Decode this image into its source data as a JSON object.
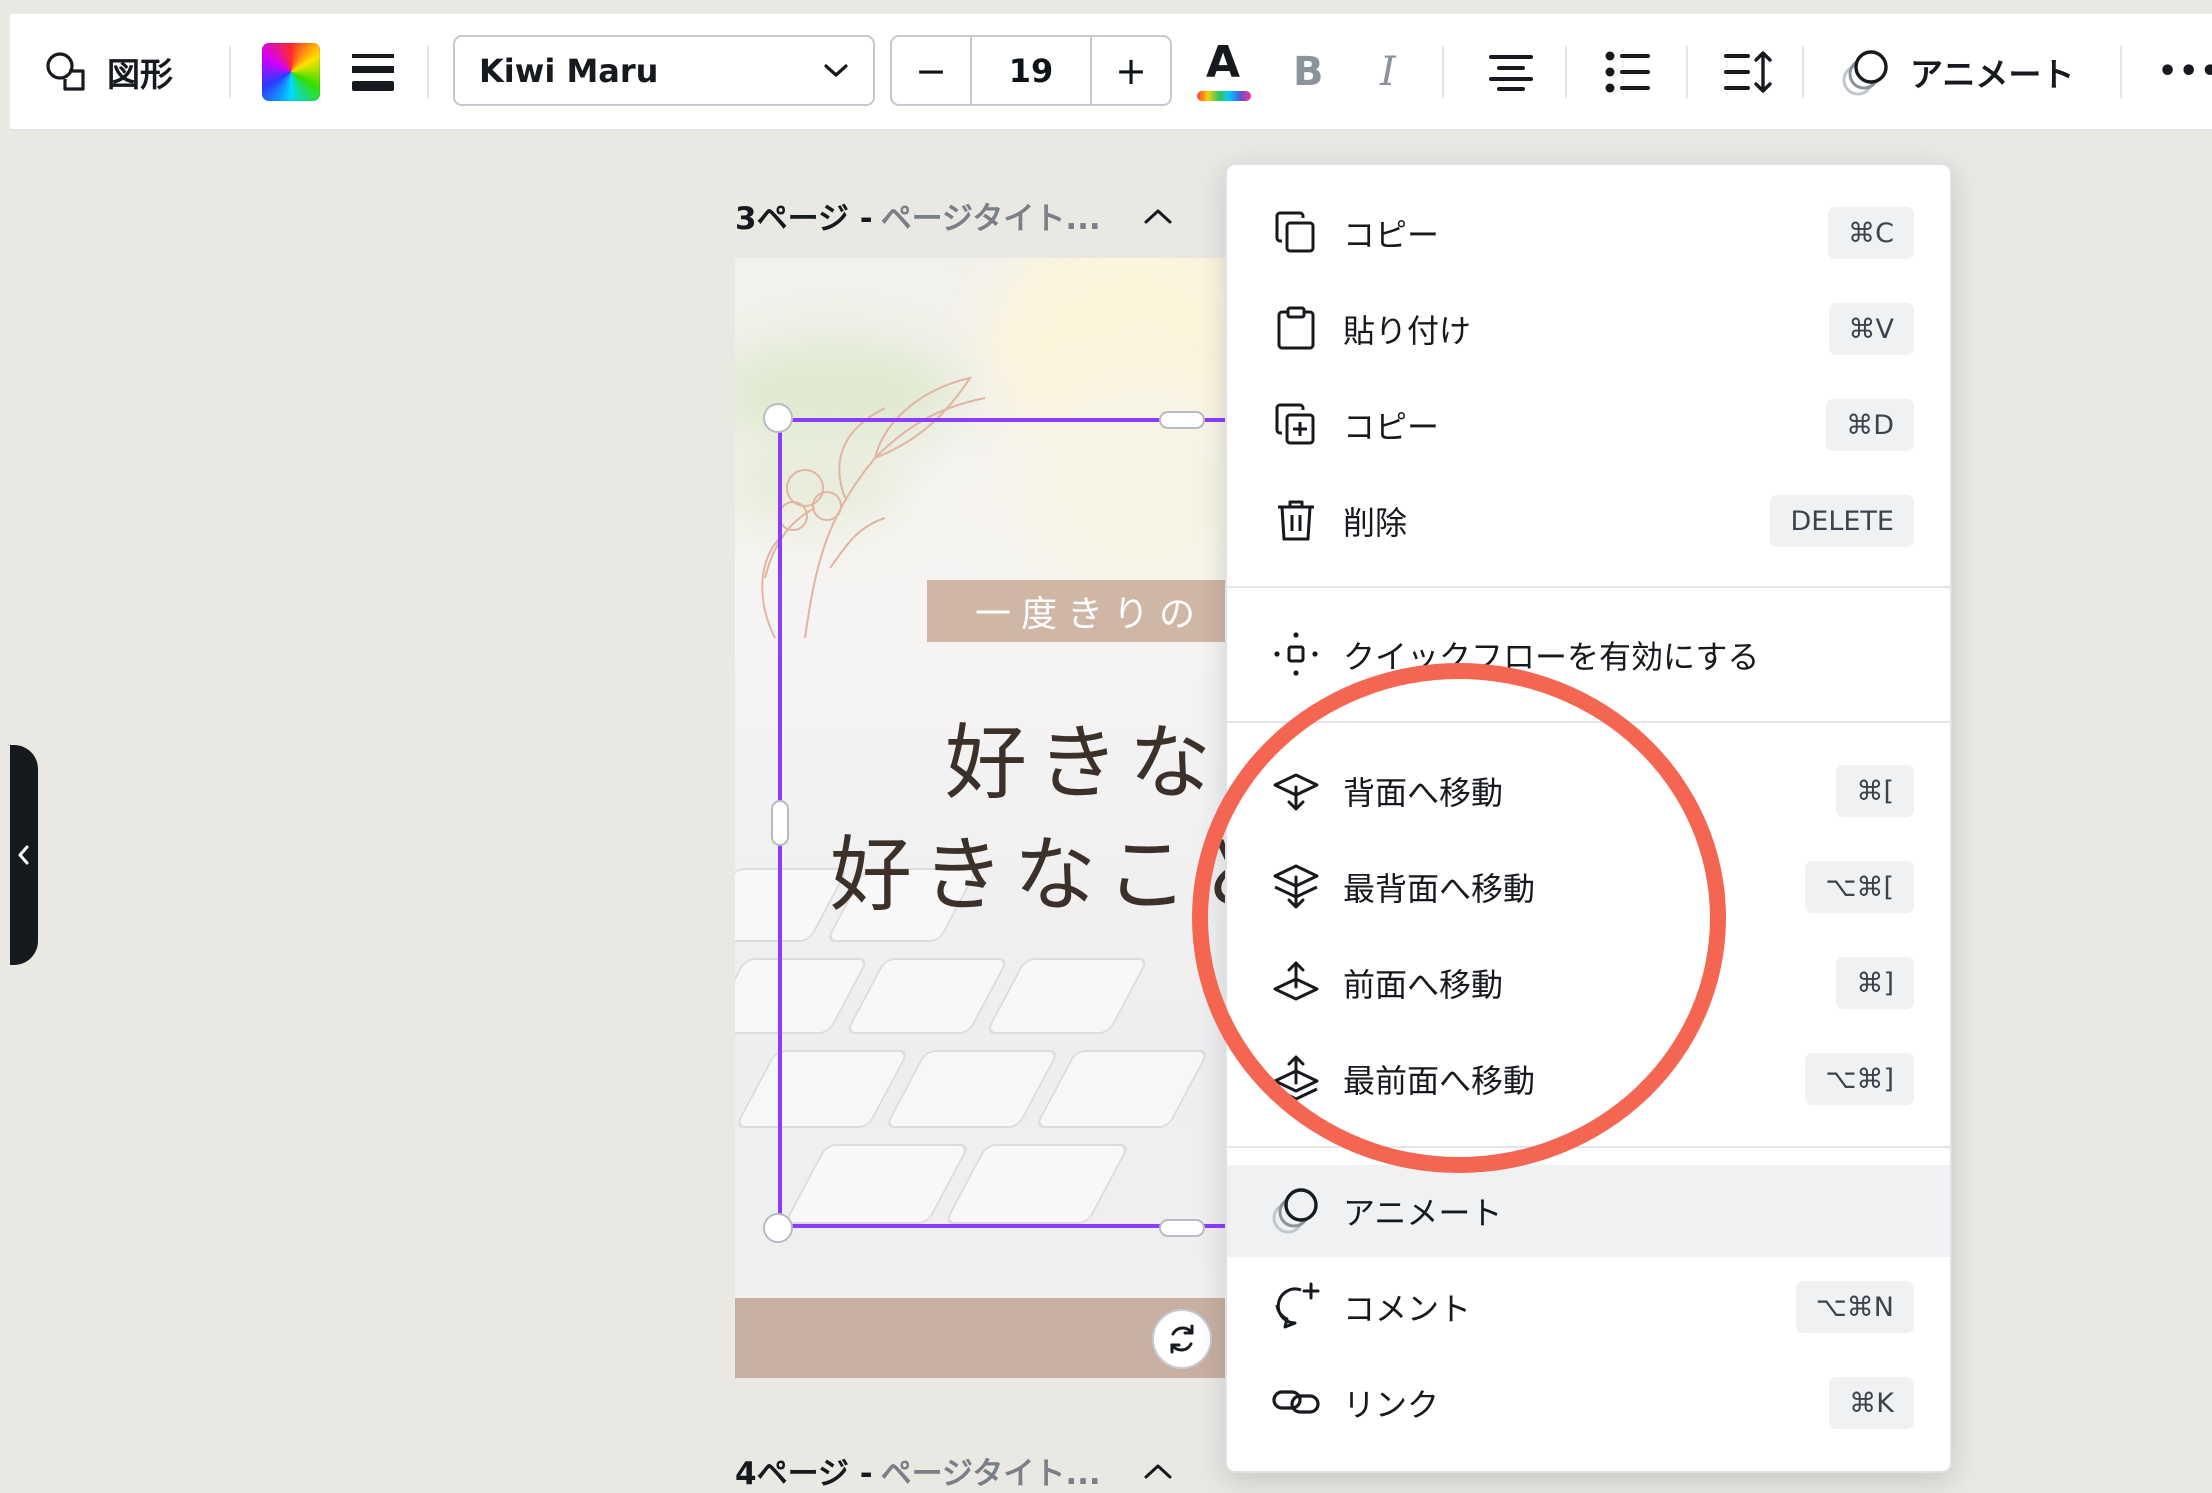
{
  "toolbar": {
    "shape_label": "図形",
    "font_name": "Kiwi Maru",
    "font_size": "19",
    "minus_label": "−",
    "plus_label": "+",
    "bold_label": "B",
    "italic_label": "I",
    "animate_label": "アニメート",
    "more_label": "•••",
    "text_color_letter": "A"
  },
  "canvas": {
    "page3": {
      "number": "3ページ - ",
      "title": "ページタイト..."
    },
    "page4": {
      "number": "4ページ - ",
      "title": "ページタイト..."
    },
    "design": {
      "label_text": "一度きりの",
      "headline_line1": "好きなと",
      "headline_line2": "好きなこと"
    }
  },
  "context_menu": {
    "items": [
      {
        "label": "コピー",
        "shortcut": "⌘C",
        "icon": "copy-icon"
      },
      {
        "label": "貼り付け",
        "shortcut": "⌘V",
        "icon": "clipboard-icon"
      },
      {
        "label": "コピー",
        "shortcut": "⌘D",
        "icon": "duplicate-icon"
      },
      {
        "label": "削除",
        "shortcut": "DELETE",
        "icon": "trash-icon"
      },
      {
        "label": "クイックフローを有効にする",
        "shortcut": "",
        "icon": "quickflow-icon"
      },
      {
        "label": "背面へ移動",
        "shortcut": "⌘[",
        "icon": "send-backward-icon"
      },
      {
        "label": "最背面へ移動",
        "shortcut": "⌥⌘[",
        "icon": "send-to-back-icon"
      },
      {
        "label": "前面へ移動",
        "shortcut": "⌘]",
        "icon": "bring-forward-icon"
      },
      {
        "label": "最前面へ移動",
        "shortcut": "⌥⌘]",
        "icon": "bring-to-front-icon"
      },
      {
        "label": "アニメート",
        "shortcut": "",
        "icon": "animate-icon"
      },
      {
        "label": "コメント",
        "shortcut": "⌥⌘N",
        "icon": "comment-icon"
      },
      {
        "label": "リンク",
        "shortcut": "⌘K",
        "icon": "link-icon"
      }
    ]
  },
  "colors": {
    "selection": "#8b3dff",
    "annotation_circle": "#f46552",
    "label_bar": "#cfb6a5",
    "footer_bar": "#c7b0a1",
    "menu_highlight": "#f0f1f3"
  }
}
